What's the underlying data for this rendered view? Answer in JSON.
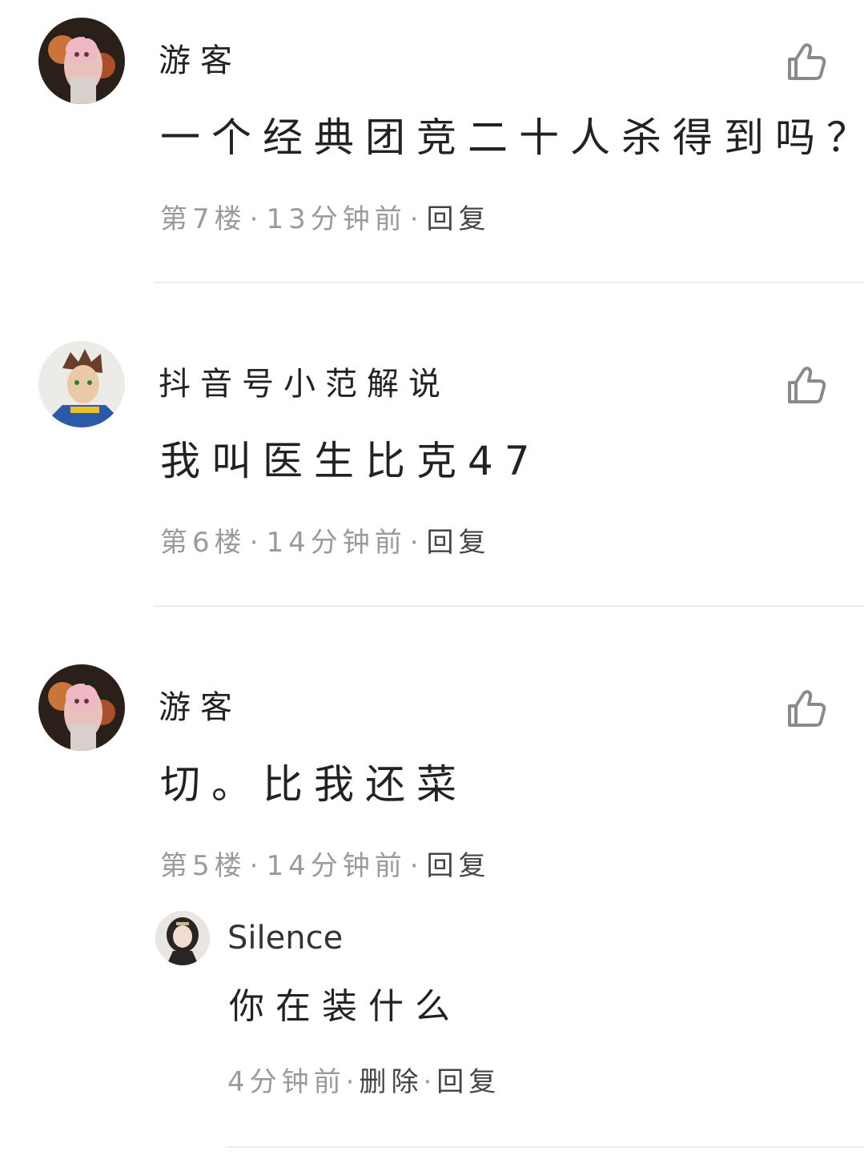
{
  "comments": [
    {
      "username": "游客",
      "text": "一个经典团竞二十人杀得到吗？",
      "floor": "第7楼",
      "time": "13分钟前",
      "reply": "回复",
      "avatar_icon": "anime-girl-avatar",
      "like_icon": "thumbs-up-icon"
    },
    {
      "username": "抖音号小范解说",
      "text": "我叫医生比克47",
      "floor": "第6楼",
      "time": "14分钟前",
      "reply": "回复",
      "avatar_icon": "anime-boy-avatar",
      "like_icon": "thumbs-up-icon"
    },
    {
      "username": "游客",
      "text": "切。比我还菜",
      "floor": "第5楼",
      "time": "14分钟前",
      "reply": "回复",
      "avatar_icon": "anime-girl-avatar",
      "like_icon": "thumbs-up-icon",
      "sub_reply": {
        "username": "Silence",
        "text": "你在装什么",
        "time": "4分钟前",
        "delete": "删除",
        "reply": "回复",
        "avatar_icon": "dark-hair-girl-avatar"
      }
    }
  ],
  "separator": "·",
  "colors": {
    "text": "#222222",
    "meta": "#9a9a9a",
    "divider": "#ececec",
    "icon": "#8a8a8a"
  }
}
